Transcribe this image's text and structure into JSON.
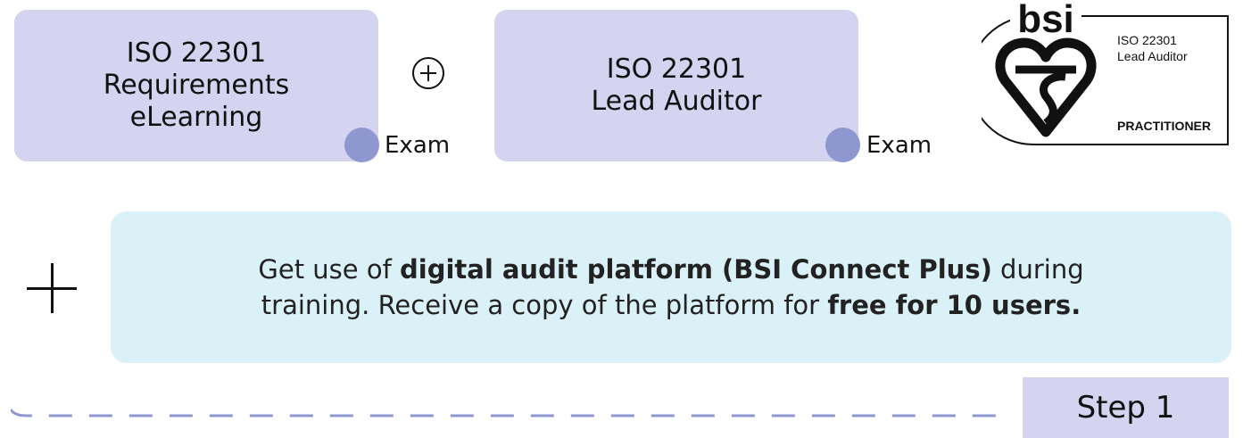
{
  "courses": [
    {
      "lines": [
        "ISO 22301",
        "Requirements",
        "eLearning"
      ],
      "exam_label": "Exam"
    },
    {
      "lines": [
        "ISO 22301",
        "Lead Auditor"
      ],
      "exam_label": "Exam"
    }
  ],
  "badge": {
    "logo_text": "bsi",
    "line1": "ISO 22301",
    "line2": "Lead Auditor",
    "level": "PRACTITIONER"
  },
  "info": {
    "part1": "Get use of ",
    "bold1": "digital audit platform (BSI Connect Plus)",
    "part2": " during",
    "part3": "training. Receive a copy of the platform for ",
    "bold2": "free for 10 users."
  },
  "step": {
    "label": "Step 1"
  },
  "colors": {
    "course_box": "#d4d4f0",
    "exam_dot": "#8e97d0",
    "info_box": "#daf1f7",
    "dash_line": "#8e97d0"
  }
}
